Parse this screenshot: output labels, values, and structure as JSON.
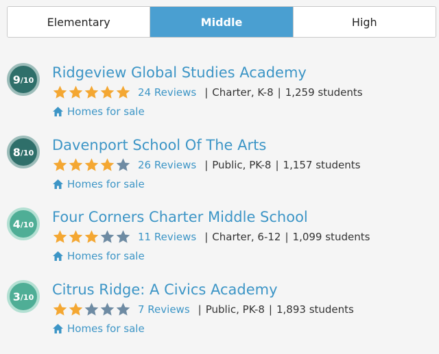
{
  "tabs": [
    {
      "label": "Elementary",
      "active": false
    },
    {
      "label": "Middle",
      "active": true
    },
    {
      "label": "High",
      "active": false
    }
  ],
  "colors": {
    "accent": "#4a9fd1",
    "link": "#3c95c6",
    "star_filled": "#f4a732",
    "star_empty": "#6e8ba3",
    "rating_high": "#2f6f6a",
    "rating_high_ring": "#9dbdba",
    "rating_mid": "#4fae96",
    "rating_mid_ring": "#b4e0d3"
  },
  "schools": [
    {
      "rating": "9",
      "rating_denominator": "/10",
      "rating_tier": "high",
      "name": "Ridgeview Global Studies Academy",
      "stars": 5,
      "reviews": "24 Reviews",
      "type_grades": "Charter, K-8",
      "students": "1,259 students",
      "homes_label": "Homes for sale"
    },
    {
      "rating": "8",
      "rating_denominator": "/10",
      "rating_tier": "high",
      "name": "Davenport School Of The Arts",
      "stars": 4,
      "reviews": "26 Reviews",
      "type_grades": "Public, PK-8",
      "students": "1,157 students",
      "homes_label": "Homes for sale"
    },
    {
      "rating": "4",
      "rating_denominator": "/10",
      "rating_tier": "mid",
      "name": "Four Corners Charter Middle School",
      "stars": 3,
      "reviews": "11 Reviews",
      "type_grades": "Charter, 6-12",
      "students": "1,099 students",
      "homes_label": "Homes for sale"
    },
    {
      "rating": "3",
      "rating_denominator": "/10",
      "rating_tier": "mid",
      "name": "Citrus Ridge: A Civics Academy",
      "stars": 2,
      "reviews": "7 Reviews",
      "type_grades": "Public, PK-8",
      "students": "1,893 students",
      "homes_label": "Homes for sale"
    }
  ]
}
